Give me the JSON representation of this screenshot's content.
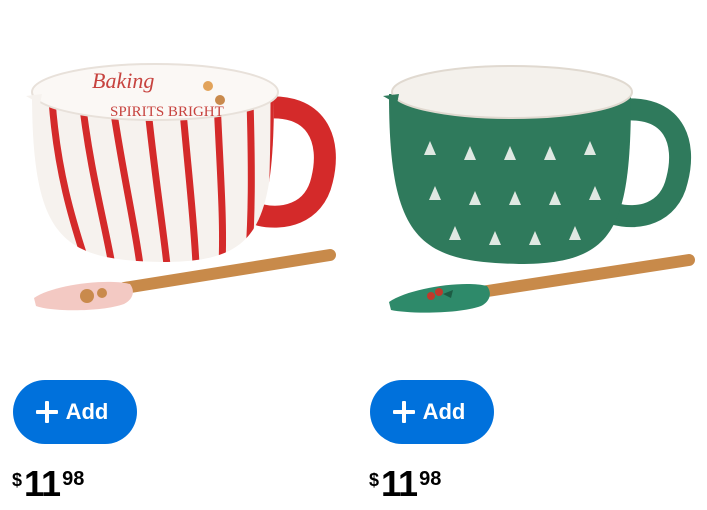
{
  "products": [
    {
      "name": "Baking Spirits Bright striped batter bowl with spatula",
      "bowl_text_line1": "Baking",
      "bowl_text_line2": "SPIRITS BRIGHT",
      "add_label": "Add",
      "price": {
        "currency": "$",
        "dollars": "11",
        "cents": "98"
      },
      "colors": {
        "stripe": "#d42a2a",
        "bowl": "#f6f2ee",
        "spatula_head": "#f3c9c3"
      }
    },
    {
      "name": "Green Christmas tree batter bowl with spatula",
      "add_label": "Add",
      "price": {
        "currency": "$",
        "dollars": "11",
        "cents": "98"
      },
      "colors": {
        "bowl": "#2f7a5c",
        "spatula_head": "#2e8a6a"
      }
    }
  ],
  "colors": {
    "accent": "#0071dc",
    "text": "#000000"
  }
}
